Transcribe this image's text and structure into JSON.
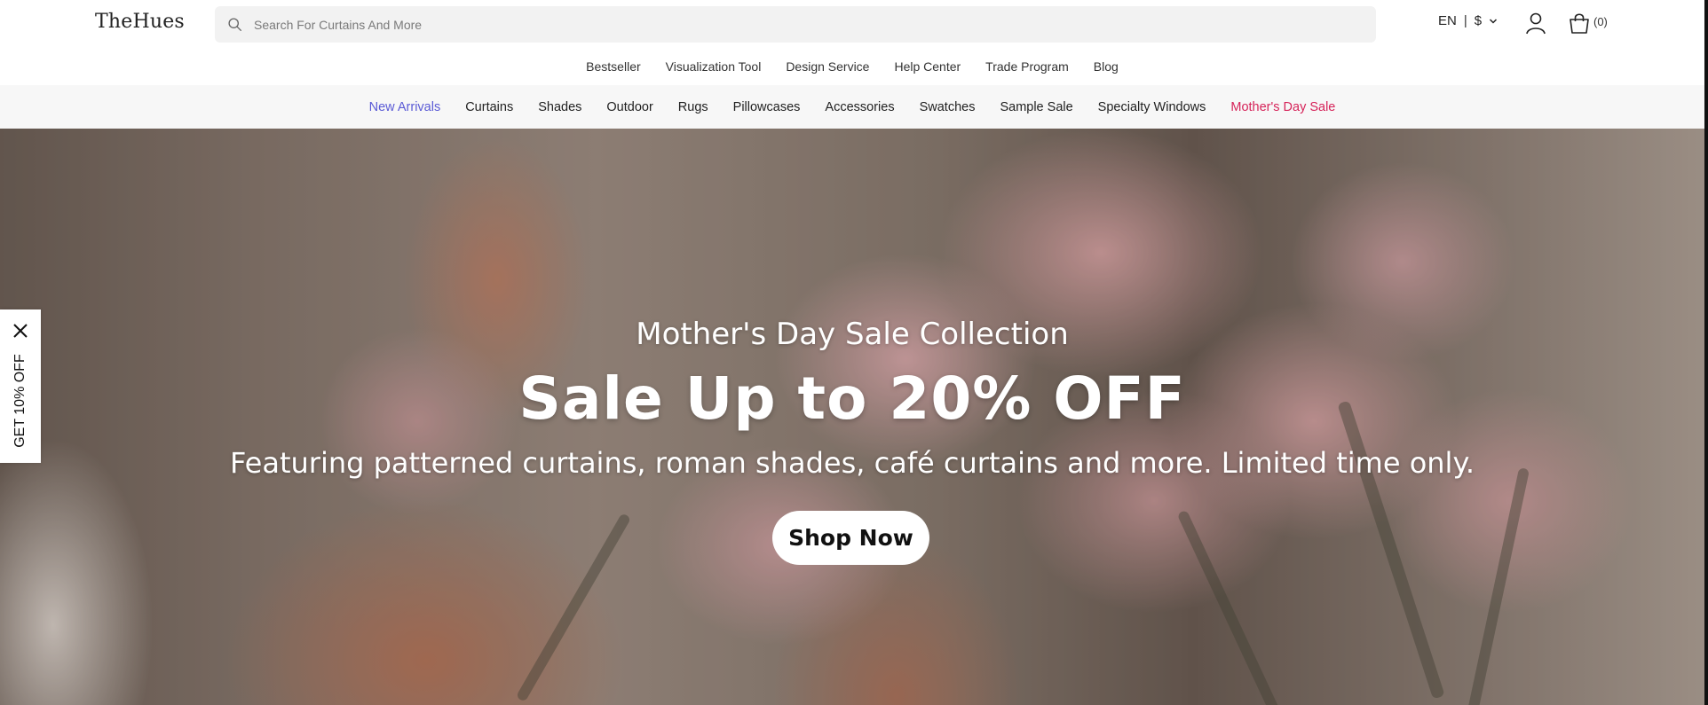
{
  "header": {
    "logo": "TheHues",
    "search_placeholder": "Search For Curtains And More",
    "language": "EN",
    "currency": "$",
    "cart_count": "(0)"
  },
  "subnav": {
    "items": [
      "Bestseller",
      "Visualization Tool",
      "Design Service",
      "Help Center",
      "Trade Program",
      "Blog"
    ]
  },
  "catnav": {
    "items": [
      "New Arrivals",
      "Curtains",
      "Shades",
      "Outdoor",
      "Rugs",
      "Pillowcases",
      "Accessories",
      "Swatches",
      "Sample Sale",
      "Specialty Windows",
      "Mother's Day Sale"
    ],
    "highlight_new_color": "#5b5bd6",
    "highlight_sale_color": "#d6245a"
  },
  "hero": {
    "subtitle": "Mother's Day Sale Collection",
    "title": "Sale Up to 20% OFF",
    "description": "Featuring patterned curtains, roman shades, café curtains and more. Limited time only.",
    "cta": "Shop Now"
  },
  "side_tab": {
    "label": "GET 10% OFF"
  }
}
